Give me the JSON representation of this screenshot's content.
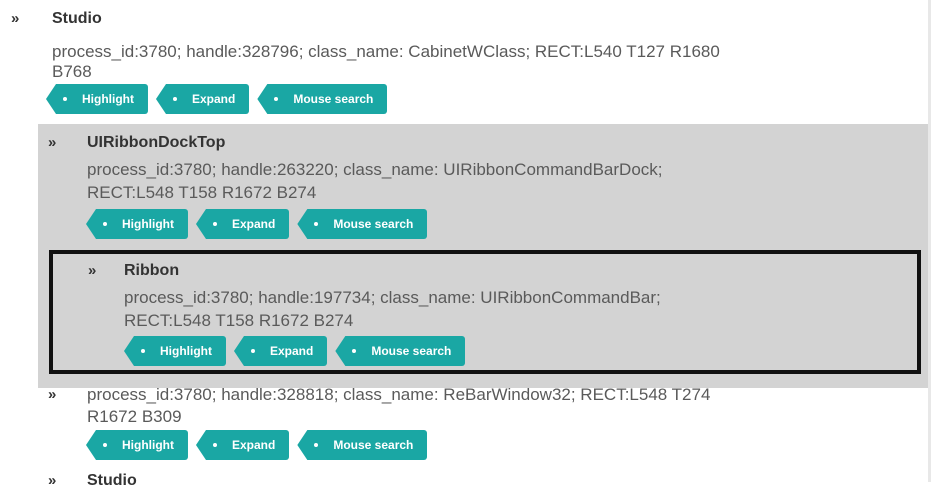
{
  "buttons": {
    "highlight": "Highlight",
    "expand": "Expand",
    "mouse_search": "Mouse search"
  },
  "tree": {
    "root": {
      "chevron": "»",
      "title": "Studio",
      "desc_line1": "process_id:3780; handle:328796; class_name: CabinetWClass; RECT:L540 T127 R1680",
      "desc_line2": "B768"
    },
    "ribbon_dock": {
      "chevron": "»",
      "title": "UIRibbonDockTop",
      "desc_line1": "process_id:3780; handle:263220; class_name: UIRibbonCommandBarDock;",
      "desc_line2": "RECT:L548 T158 R1672 B274"
    },
    "ribbon": {
      "chevron": "»",
      "title": "Ribbon",
      "desc_line1": "process_id:3780; handle:197734; class_name: UIRibbonCommandBar;",
      "desc_line2": "RECT:L548 T158 R1672 B274"
    },
    "rebar": {
      "chevron": "»",
      "desc_line1": "process_id:3780; handle:328818; class_name: ReBarWindow32; RECT:L548 T274",
      "desc_line2": "R1672 B309"
    },
    "next": {
      "chevron": "»",
      "title": "Studio"
    }
  }
}
